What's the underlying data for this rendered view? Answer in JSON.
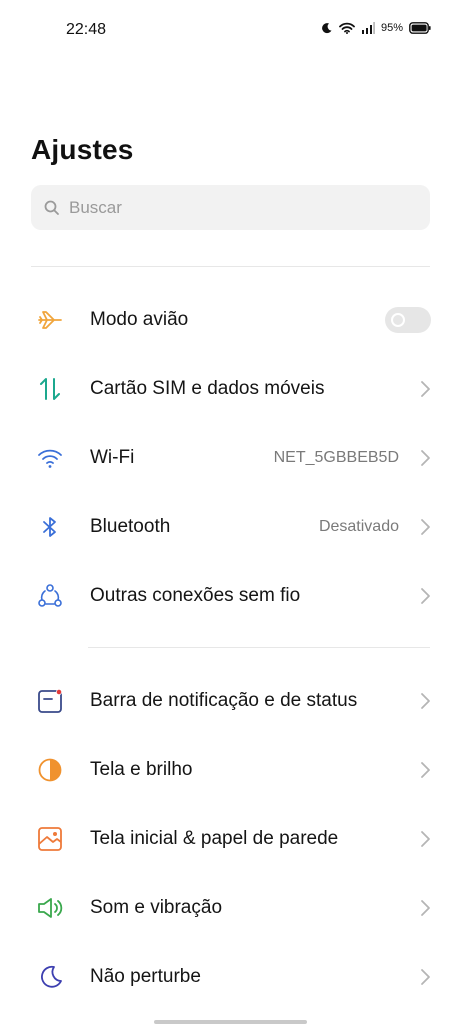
{
  "status": {
    "time": "22:48",
    "battery": "95%"
  },
  "page": {
    "title": "Ajustes"
  },
  "search": {
    "placeholder": "Buscar"
  },
  "group1": [
    {
      "label": "Modo avião",
      "icon": "airplane-icon",
      "type": "toggle",
      "on": false
    },
    {
      "label": "Cartão SIM e dados móveis",
      "icon": "sim-data-icon",
      "value": ""
    },
    {
      "label": "Wi-Fi",
      "icon": "wifi-icon",
      "value": "NET_5GBBEB5D"
    },
    {
      "label": "Bluetooth",
      "icon": "bluetooth-icon",
      "value": "Desativado"
    },
    {
      "label": "Outras conexões sem fio",
      "icon": "connections-icon",
      "value": ""
    }
  ],
  "group2": [
    {
      "label": "Barra de notificação e de status",
      "icon": "notification-bar-icon"
    },
    {
      "label": "Tela e brilho",
      "icon": "brightness-icon"
    },
    {
      "label": "Tela inicial & papel de parede",
      "icon": "wallpaper-icon"
    },
    {
      "label": "Som e vibração",
      "icon": "sound-icon"
    },
    {
      "label": "Não perturbe",
      "icon": "moon-icon"
    }
  ],
  "colors": {
    "airplane": "#f0a53c",
    "sim": "#1ba88e",
    "wifi": "#3a6fd8",
    "bluetooth": "#3a6fd8",
    "connections": "#3a6fd8",
    "notify": "#3a4a8a",
    "notify_dot": "#e23b3b",
    "brightness": "#f0922e",
    "wallpaper": "#ee7a3a",
    "sound": "#3aa84d",
    "moon": "#3d3fb0"
  }
}
